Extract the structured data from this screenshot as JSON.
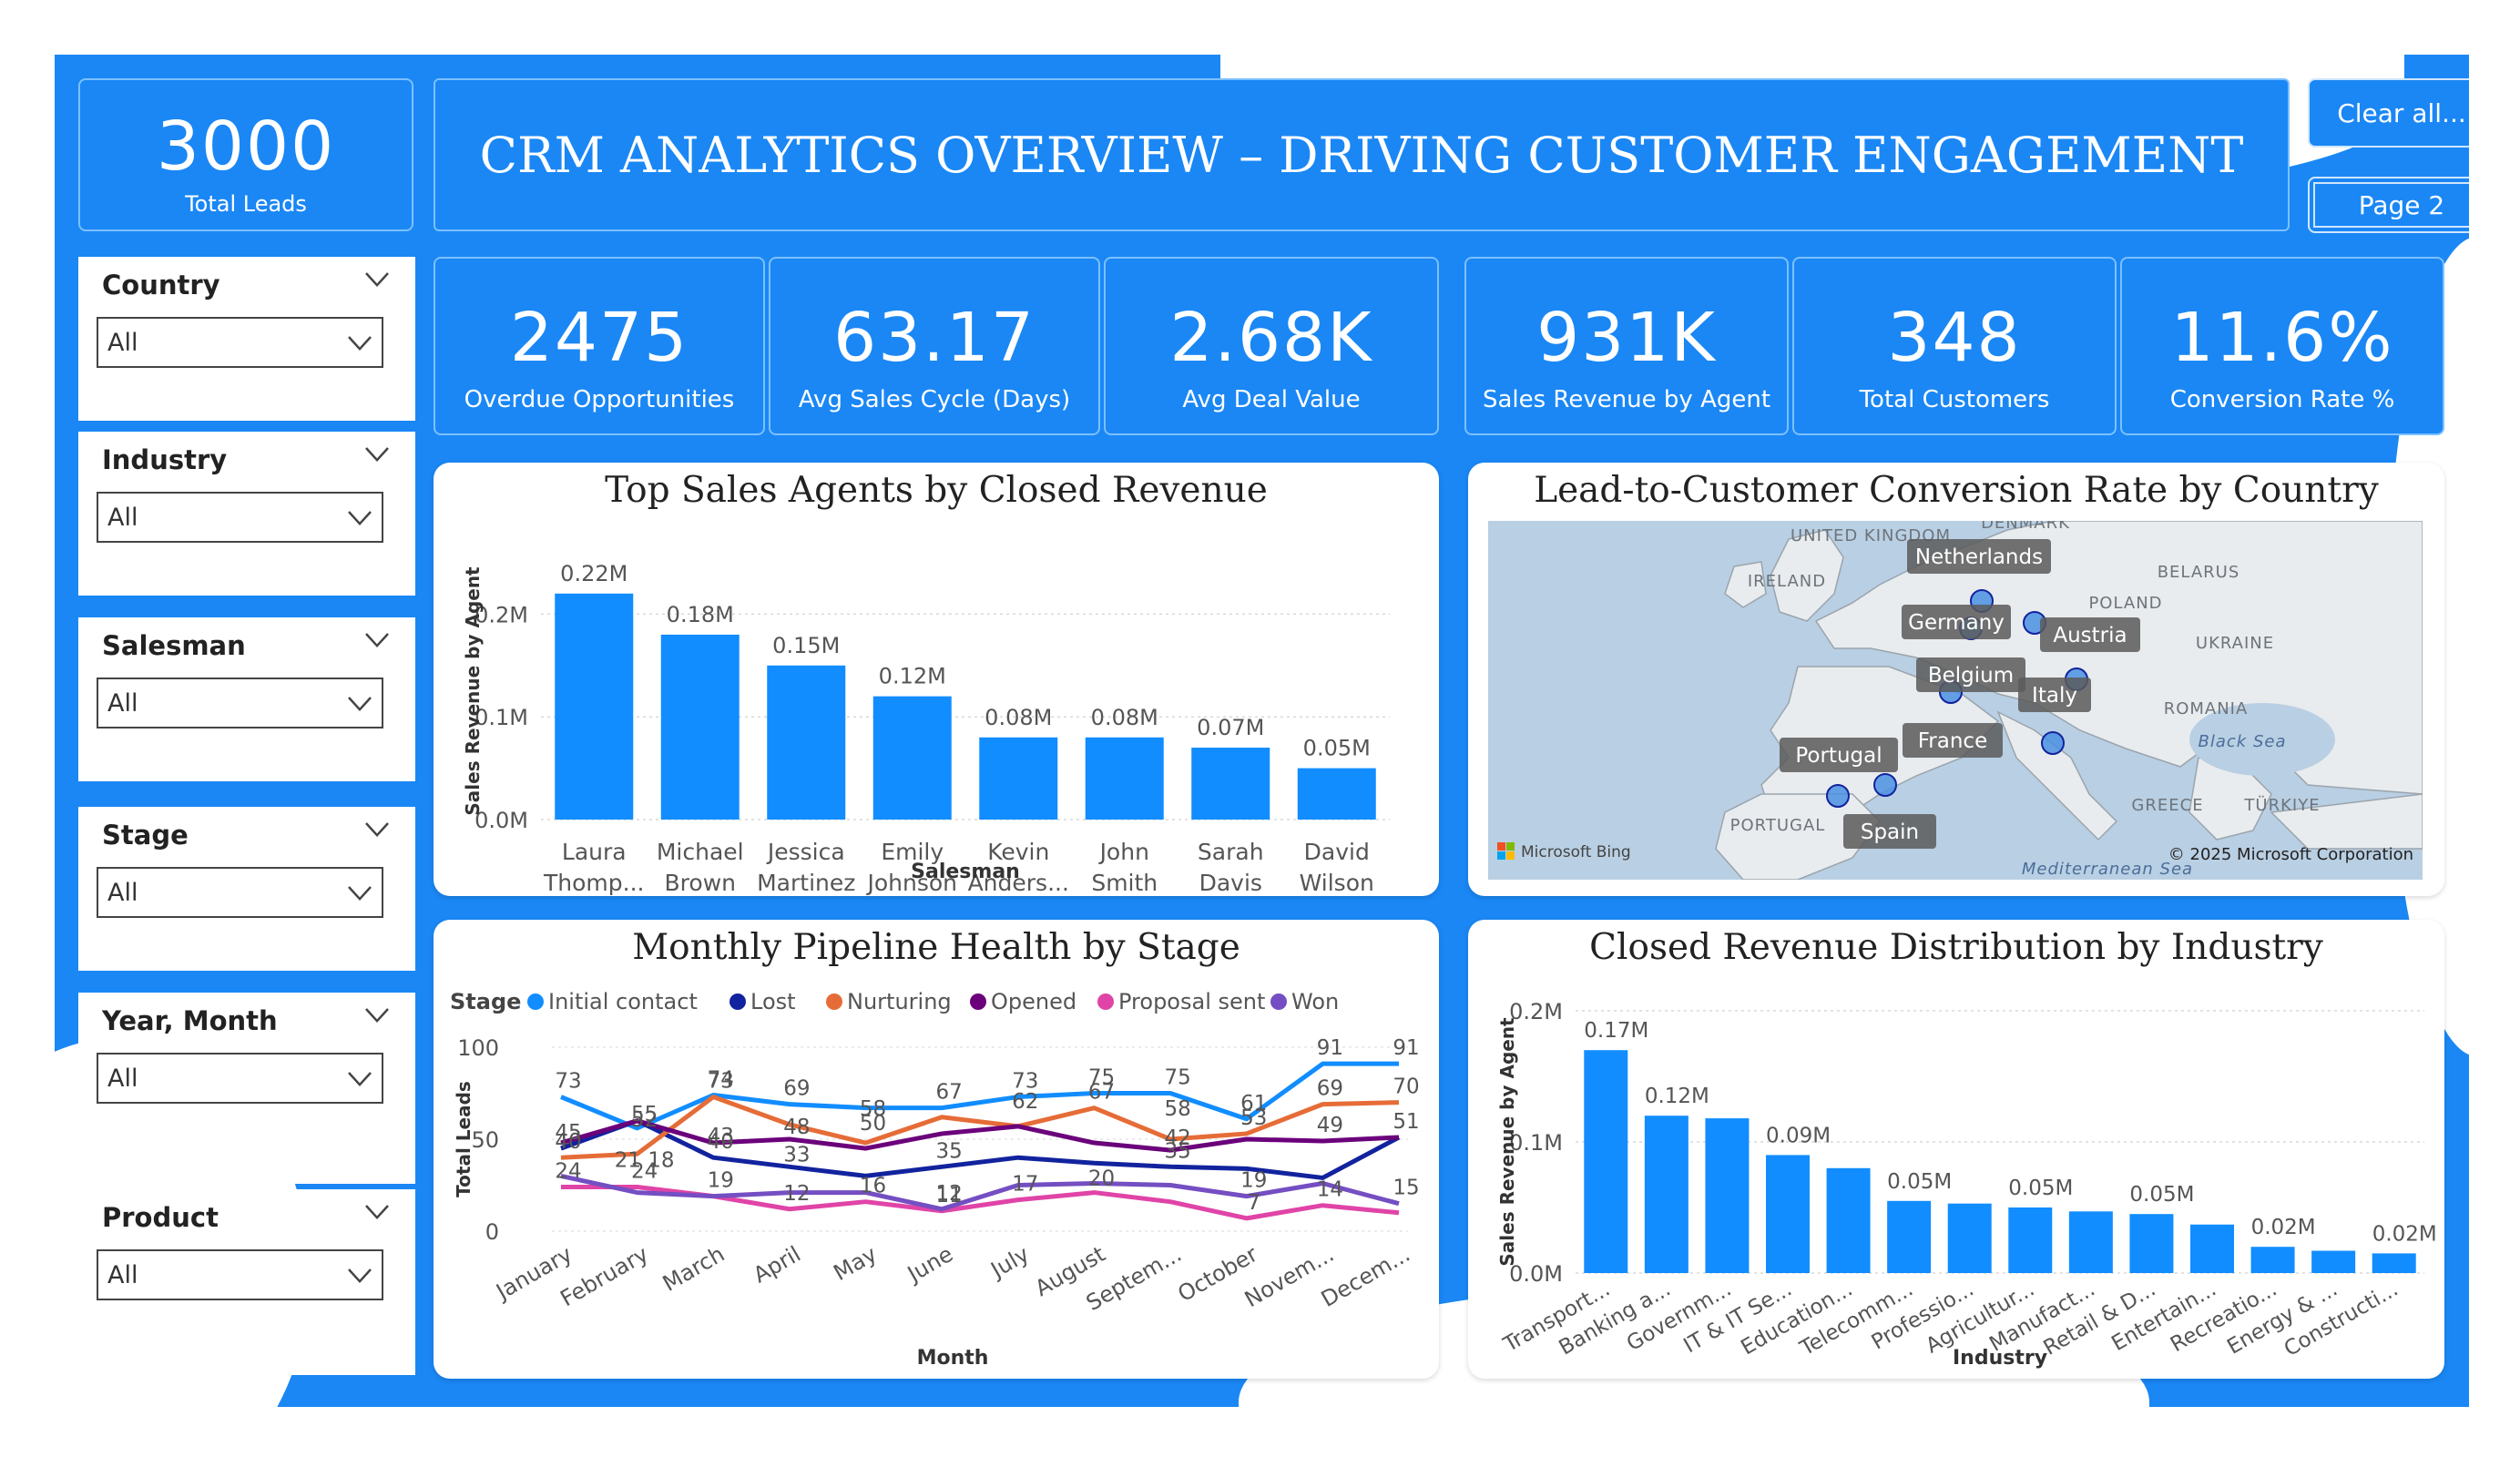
{
  "header": {
    "title": "CRM ANALYTICS OVERVIEW – DRIVING CUSTOMER ENGAGEMENT",
    "clear_label": "Clear all...",
    "page_label": "Page 2"
  },
  "kpis": {
    "total_leads": {
      "value": "3000",
      "label": "Total Leads"
    },
    "overdue": {
      "value": "2475",
      "label": "Overdue Opportunities"
    },
    "sales_cycle": {
      "value": "63.17",
      "label": "Avg Sales Cycle (Days)"
    },
    "deal_value": {
      "value": "2.68K",
      "label": "Avg Deal Value"
    },
    "revenue": {
      "value": "931K",
      "label": "Sales Revenue by Agent"
    },
    "customers": {
      "value": "348",
      "label": "Total Customers"
    },
    "conversion": {
      "value": "11.6%",
      "label": "Conversion Rate %"
    }
  },
  "slicers": [
    {
      "title": "Country",
      "value": "All"
    },
    {
      "title": "Industry",
      "value": "All"
    },
    {
      "title": "Salesman",
      "value": "All"
    },
    {
      "title": "Stage",
      "value": "All"
    },
    {
      "title": "Year, Month",
      "value": "All"
    },
    {
      "title": "Product",
      "value": "All"
    }
  ],
  "charts": {
    "agents_title": "Top Sales Agents by Closed Revenue",
    "map_title": "Lead-to-Customer Conversion Rate by Country",
    "pipeline_title": "Monthly Pipeline Health by Stage",
    "industry_title": "Closed Revenue Distribution by Industry"
  },
  "map": {
    "countries": [
      "Netherlands",
      "Germany",
      "Austria",
      "Belgium",
      "Italy",
      "France",
      "Portugal",
      "Spain"
    ],
    "base_labels": [
      "UNITED KINGDOM",
      "DENMARK",
      "IRELAND",
      "BELARUS",
      "POLAND",
      "UKRAINE",
      "ROMANIA",
      "Black Sea",
      "GREECE",
      "TÜRKIYE",
      "PORTUGAL",
      "Mediterranean Sea"
    ],
    "bing": "Microsoft Bing",
    "copyright": "© 2025 Microsoft Corporation"
  },
  "chart_data": [
    {
      "type": "bar",
      "title": "Top Sales Agents by Closed Revenue",
      "xlabel": "Salesman",
      "ylabel": "Sales Revenue by Agent",
      "categories": [
        [
          "Laura",
          "Thomp..."
        ],
        [
          "Michael",
          "Brown"
        ],
        [
          "Jessica",
          "Martinez"
        ],
        [
          "Emily",
          "Johnson"
        ],
        [
          "Kevin",
          "Anders..."
        ],
        [
          "John",
          "Smith"
        ],
        [
          "Sarah",
          "Davis"
        ],
        [
          "David",
          "Wilson"
        ]
      ],
      "values": [
        0.22,
        0.18,
        0.15,
        0.12,
        0.08,
        0.08,
        0.07,
        0.05
      ],
      "data_labels": [
        "0.22M",
        "0.18M",
        "0.15M",
        "0.12M",
        "0.08M",
        "0.08M",
        "0.07M",
        "0.05M"
      ],
      "yticks": [
        "0.0M",
        "0.1M",
        "0.2M"
      ],
      "ylim": [
        0,
        0.25
      ],
      "color": "#118dff"
    },
    {
      "type": "line",
      "title": "Monthly Pipeline Health by Stage",
      "xlabel": "Month",
      "ylabel": "Total Leads",
      "legend_title": "Stage",
      "categories": [
        "January",
        "February",
        "March",
        "April",
        "May",
        "June",
        "July",
        "August",
        "Septem...",
        "October",
        "Novem...",
        "Decem..."
      ],
      "yticks": [
        "0",
        "50",
        "100"
      ],
      "ylim": [
        0,
        100
      ],
      "series": [
        {
          "name": "Initial contact",
          "color": "#118dff",
          "values": [
            73,
            56,
            74,
            69,
            67,
            67,
            73,
            75,
            75,
            61,
            91,
            91
          ]
        },
        {
          "name": "Lost",
          "color": "#12239e",
          "values": [
            45,
            60,
            40,
            35,
            30,
            35,
            40,
            37,
            35,
            34,
            29,
            51
          ]
        },
        {
          "name": "Nurturing",
          "color": "#e66c37",
          "values": [
            40,
            42,
            73,
            58,
            48,
            62,
            57,
            67,
            50,
            53,
            69,
            70
          ]
        },
        {
          "name": "Opened",
          "color": "#6b007b",
          "values": [
            48,
            60,
            48,
            50,
            45,
            53,
            57,
            48,
            44,
            50,
            49,
            51
          ]
        },
        {
          "name": "Proposal sent",
          "color": "#e044a7",
          "values": [
            24,
            24,
            19,
            12,
            16,
            11,
            17,
            21,
            16,
            7,
            14,
            10
          ]
        },
        {
          "name": "Won",
          "color": "#744ec2",
          "values": [
            30,
            21,
            19,
            21,
            21,
            12,
            25,
            26,
            25,
            19,
            26,
            15
          ]
        }
      ],
      "point_labels": [
        {
          "i": 0,
          "v": 73,
          "t": "73"
        },
        {
          "i": 0,
          "v": 40,
          "t": "40"
        },
        {
          "i": 0,
          "v": 45,
          "t": "45"
        },
        {
          "i": 0,
          "v": 24,
          "t": "24"
        },
        {
          "i": 1,
          "v": 52,
          "t": "52"
        },
        {
          "i": 1,
          "v": 55,
          "t": "55"
        },
        {
          "i": 1,
          "v": 24,
          "t": "24"
        },
        {
          "i": 1,
          "v": 30,
          "t": "21 18"
        },
        {
          "i": 2,
          "v": 73,
          "t": "73"
        },
        {
          "i": 2,
          "v": 74,
          "t": "74"
        },
        {
          "i": 2,
          "v": 40,
          "t": "40"
        },
        {
          "i": 2,
          "v": 43,
          "t": "43"
        },
        {
          "i": 2,
          "v": 19,
          "t": "19"
        },
        {
          "i": 3,
          "v": 69,
          "t": "69"
        },
        {
          "i": 3,
          "v": 48,
          "t": "48"
        },
        {
          "i": 3,
          "v": 33,
          "t": "33"
        },
        {
          "i": 3,
          "v": 12,
          "t": "12"
        },
        {
          "i": 4,
          "v": 58,
          "t": "58"
        },
        {
          "i": 4,
          "v": 50,
          "t": "50"
        },
        {
          "i": 4,
          "v": 16,
          "t": "16"
        },
        {
          "i": 5,
          "v": 67,
          "t": "67"
        },
        {
          "i": 5,
          "v": 35,
          "t": "35"
        },
        {
          "i": 5,
          "v": 12,
          "t": "12"
        },
        {
          "i": 5,
          "v": 11,
          "t": "11"
        },
        {
          "i": 6,
          "v": 73,
          "t": "73"
        },
        {
          "i": 6,
          "v": 62,
          "t": "62"
        },
        {
          "i": 6,
          "v": 17,
          "t": "17"
        },
        {
          "i": 7,
          "v": 75,
          "t": "75"
        },
        {
          "i": 7,
          "v": 67,
          "t": "67"
        },
        {
          "i": 7,
          "v": 20,
          "t": "20"
        },
        {
          "i": 8,
          "v": 75,
          "t": "75"
        },
        {
          "i": 8,
          "v": 58,
          "t": "58"
        },
        {
          "i": 8,
          "v": 35,
          "t": "35"
        },
        {
          "i": 8,
          "v": 42,
          "t": "42"
        },
        {
          "i": 9,
          "v": 61,
          "t": "61"
        },
        {
          "i": 9,
          "v": 53,
          "t": "53"
        },
        {
          "i": 9,
          "v": 19,
          "t": "19"
        },
        {
          "i": 9,
          "v": 7,
          "t": "7"
        },
        {
          "i": 10,
          "v": 91,
          "t": "91"
        },
        {
          "i": 10,
          "v": 69,
          "t": "69"
        },
        {
          "i": 10,
          "v": 49,
          "t": "49"
        },
        {
          "i": 10,
          "v": 14,
          "t": "14"
        },
        {
          "i": 11,
          "v": 91,
          "t": "91"
        },
        {
          "i": 11,
          "v": 70,
          "t": "70"
        },
        {
          "i": 11,
          "v": 51,
          "t": "51"
        },
        {
          "i": 11,
          "v": 15,
          "t": "15"
        }
      ]
    },
    {
      "type": "bar",
      "title": "Closed Revenue Distribution by Industry",
      "xlabel": "Industry",
      "ylabel": "Sales Revenue by Agent",
      "categories": [
        "Transport...",
        "Banking a...",
        "Governm...",
        "IT & IT Se...",
        "Education...",
        "Telecomm...",
        "Professio...",
        "Agricultur...",
        "Manufact...",
        "Retail & D...",
        "Entertain...",
        "Recreatio...",
        "Energy & ...",
        "Constructi..."
      ],
      "values": [
        0.17,
        0.12,
        0.118,
        0.09,
        0.08,
        0.055,
        0.053,
        0.05,
        0.047,
        0.045,
        0.037,
        0.02,
        0.017,
        0.015
      ],
      "data_labels": [
        "0.17M",
        "0.12M",
        "",
        "0.09M",
        "",
        "0.05M",
        "",
        "0.05M",
        "",
        "0.05M",
        "",
        "0.02M",
        "",
        "0.02M"
      ],
      "yticks": [
        "0.0M",
        "0.1M",
        "0.2M"
      ],
      "ylim": [
        0,
        0.2
      ],
      "color": "#118dff"
    }
  ]
}
